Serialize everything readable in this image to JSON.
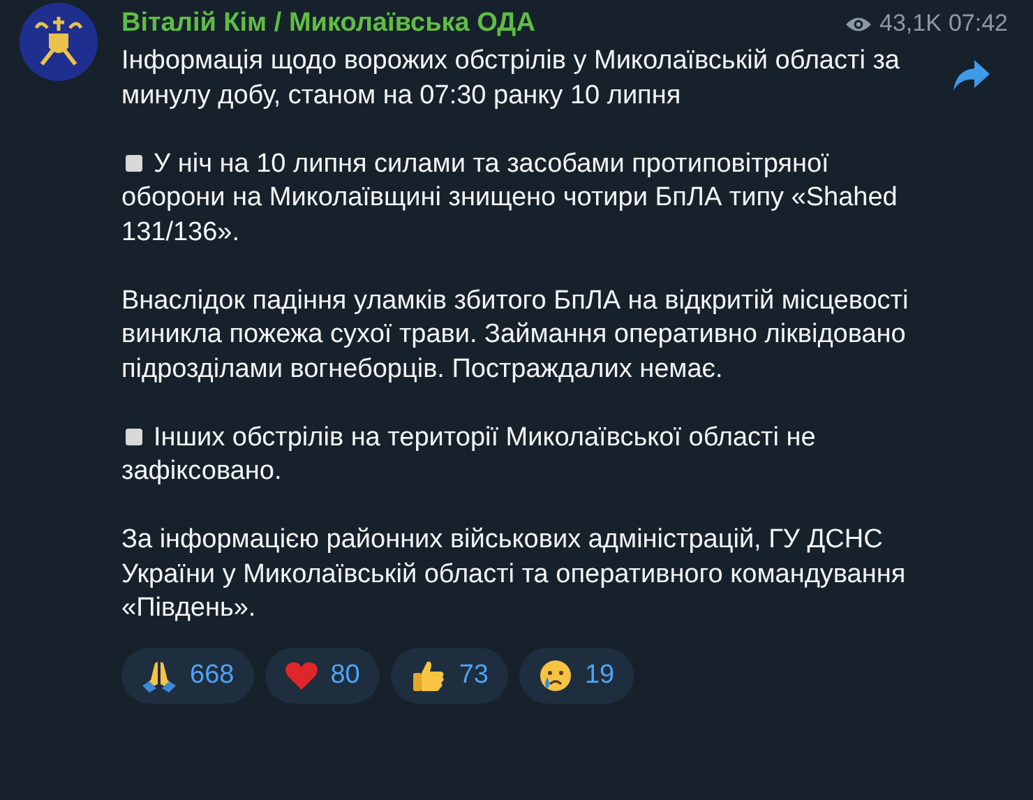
{
  "channel": {
    "name": "Віталій Кім / Миколаївська ОДА",
    "views": "43,1K",
    "time": "07:42"
  },
  "paragraphs": [
    {
      "kind": "plain",
      "text": "Інформація щодо ворожих обстрілів у Миколаївській області за минулу добу, станом на 07:30 ранку 10 липня"
    },
    {
      "kind": "bullet",
      "text": "У ніч на 10 липня силами та засобами протиповітряної оборони на Миколаївщині знищено чотири БпЛА типу «Shahed 131/136»."
    },
    {
      "kind": "plain",
      "text": "Внаслідок падіння уламків збитого БпЛА на відкритій місцевості виникла пожежа сухої трави. Займання оперативно ліквідовано підрозділами вогнеборців. Постраждалих немає."
    },
    {
      "kind": "bullet",
      "text": "Інших обстрілів на території Миколаївської області не зафіксовано."
    },
    {
      "kind": "plain",
      "text": "За інформацією районних військових адміністрацій, ГУ ДСНС України у Миколаївській області та оперативного командування «Південь»."
    }
  ],
  "reactions": [
    {
      "kind": "pray",
      "count": "668"
    },
    {
      "kind": "heart",
      "count": "80"
    },
    {
      "kind": "thumbs_up",
      "count": "73"
    },
    {
      "kind": "crying",
      "count": "19"
    }
  ]
}
